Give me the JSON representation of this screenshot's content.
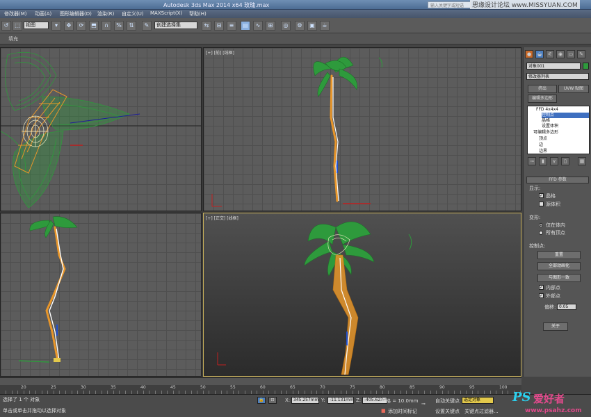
{
  "app": {
    "title": "Autodesk 3ds Max  2014 x64     玫瑰.max",
    "search_placeholder": "输入关键字或短语",
    "watermark_top": "思缘设计论坛 www.MISSYUAN.COM"
  },
  "menu": [
    "修改器(M)",
    "动画(A)",
    "图形编辑器(D)",
    "渲染(R)",
    "自定义(U)",
    "MAXScript(X)",
    "帮助(H)"
  ],
  "toolbar": {
    "view_dropdown": "视图",
    "selection_set": "创建选择集"
  },
  "ribbon": {
    "label": "填充"
  },
  "viewports": {
    "top_right_label": "[+] [前] [线框]",
    "bottom_right_label": "[+] [正交] [线框]"
  },
  "command_panel": {
    "object_name": "对象001",
    "modifier_list": "修改器列表",
    "btn_extrude": "挤出",
    "btn_uvw": "UVW 贴图",
    "btn_edit_poly": "编辑多边形",
    "stack": [
      "FFD 4x4x4",
      "控制点",
      "晶格",
      "设置体积",
      "可编辑多边形",
      "顶点",
      "边",
      "边界"
    ],
    "ffd_params_header": "FFD 参数",
    "display_label": "显示:",
    "lattice": "晶格",
    "source_volume": "源体积",
    "deform_label": "变形:",
    "only_in_volume": "仅在体内",
    "all_vertices": "所有顶点",
    "control_points_label": "控制点:",
    "btn_reset": "重置",
    "btn_animate_all": "全部动画化",
    "btn_conform": "与图形一致",
    "inside_points": "内部点",
    "outside_points": "外部点",
    "offset_label": "偏移:",
    "offset_value": "0.05",
    "btn_about": "关于"
  },
  "timeline": {
    "ticks": [
      "20",
      "25",
      "30",
      "35",
      "40",
      "45",
      "50",
      "55",
      "60",
      "65",
      "70",
      "75",
      "80",
      "85",
      "90",
      "95",
      "100"
    ]
  },
  "status": {
    "selected": "选择了 1 个 对象",
    "prompt": "单击或单击并拖动以选择对象",
    "x_label": "X:",
    "x_value": "345.257mm",
    "y_label": "Y:",
    "y_value": "-11.131mm",
    "z_label": "Z:",
    "z_value": "-405.623m",
    "grid": "栅格 = 10.0mm",
    "auto_key": "自动关键点",
    "set_key": "设置关键点",
    "selected_object": "选定对象",
    "key_filters": "关键点过滤器...",
    "add_time_tag": "添加时间标记"
  },
  "watermark": {
    "ps_text": "PS",
    "ps_cn": "爱好者",
    "url": "www.psahz.com"
  },
  "colors": {
    "mesh_green": "#2e9a3c",
    "stem_orange": "#e8962a",
    "viewport_border_active": "#c9b15a"
  }
}
